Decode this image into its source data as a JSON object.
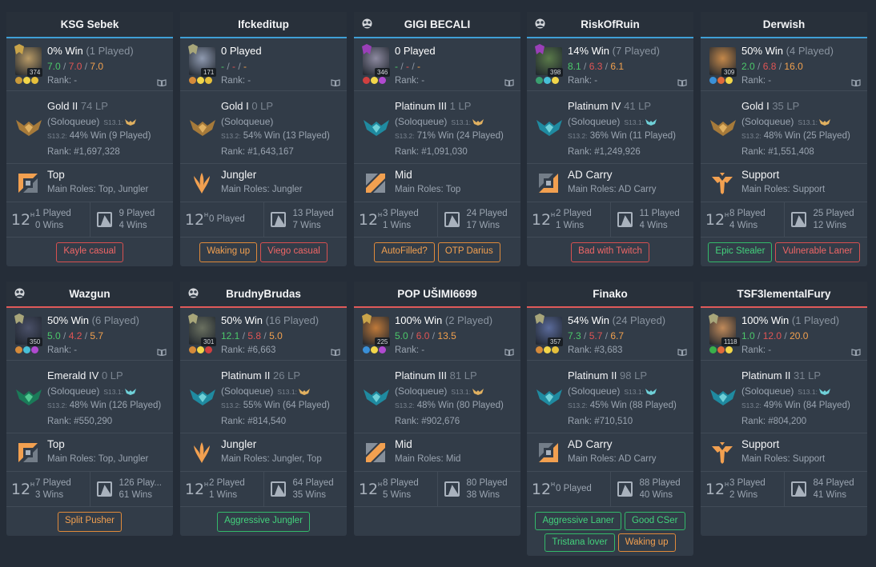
{
  "players": [
    {
      "name": "KSG Sebek",
      "team": "blue",
      "premade": false,
      "level": "374",
      "win": "0% Win",
      "played": "(1 Played)",
      "k": "7.0",
      "d": "7.0",
      "a": "7.0",
      "rank_line": "Rank: -",
      "tier": "Gold II",
      "lp": "74 LP",
      "queue": "(Soloqueue)",
      "prev_label": "S13.1:",
      "prev_tier": "gold",
      "season_label": "S13.2:",
      "season_stats": "44% Win (9 Played)",
      "ladder": "Rank: #1,697,328",
      "emblem": "gold",
      "role": "Top",
      "main_roles": "Main Roles: Top, Jungler",
      "role_icon": "top",
      "recent_played": "1 Played",
      "recent_wins": "0 Wins",
      "champ_played": "9 Played",
      "champ_wins": "4 Wins",
      "tags": [
        {
          "label": "Kayle casual",
          "color": "red"
        }
      ],
      "champ_color": "#b89a66",
      "crest": "#c9a44a",
      "runes": [
        "#c99a3a",
        "#f2d64a",
        "#e6c03c"
      ]
    },
    {
      "name": "Ifckeditup",
      "team": "blue",
      "premade": false,
      "level": "171",
      "win": "0 Played",
      "played": "",
      "k": "-",
      "d": "-",
      "a": "-",
      "rank_line": "Rank: -",
      "tier": "Gold I",
      "lp": "0 LP",
      "queue": "(Soloqueue)",
      "prev_label": "",
      "prev_tier": "",
      "season_label": "S13.2:",
      "season_stats": "54% Win (13 Played)",
      "ladder": "Rank: #1,643,167",
      "emblem": "gold",
      "role": "Jungler",
      "main_roles": "Main Roles: Jungler",
      "role_icon": "jungle",
      "recent_played": "0 Played",
      "recent_wins": "",
      "champ_played": "13 Played",
      "champ_wins": "7 Wins",
      "tags": [
        {
          "label": "Waking up",
          "color": "orange"
        },
        {
          "label": "Viego casual",
          "color": "red"
        }
      ],
      "champ_color": "#8f9ab0",
      "crest": "#a8a67a",
      "runes": [
        "#d48a3a",
        "#f2d64a",
        "#e6c03c"
      ]
    },
    {
      "name": "GIGI BECALI",
      "team": "blue",
      "premade": true,
      "level": "346",
      "win": "0 Played",
      "played": "",
      "k": "-",
      "d": "-",
      "a": "-",
      "rank_line": "Rank: -",
      "tier": "Platinum III",
      "lp": "1 LP",
      "queue": "(Soloqueue)",
      "prev_label": "S13.1:",
      "prev_tier": "gold",
      "season_label": "S13.2:",
      "season_stats": "71% Win (24 Played)",
      "ladder": "Rank: #1,091,030",
      "emblem": "platinum",
      "role": "Mid",
      "main_roles": "Main Roles: Top",
      "role_icon": "mid",
      "recent_played": "3 Played",
      "recent_wins": "1 Wins",
      "champ_played": "24 Played",
      "champ_wins": "17 Wins",
      "tags": [
        {
          "label": "AutoFilled?",
          "color": "orange"
        },
        {
          "label": "OTP Darius",
          "color": "orange"
        }
      ],
      "champ_color": "#8d8aa0",
      "crest": "#9a3fb8",
      "runes": [
        "#d04040",
        "#f2d64a",
        "#b04ad0"
      ]
    },
    {
      "name": "RiskOfRuin",
      "team": "blue",
      "premade": true,
      "level": "398",
      "win": "14% Win",
      "played": "(7 Played)",
      "k": "8.1",
      "d": "6.3",
      "a": "6.1",
      "rank_line": "Rank: -",
      "tier": "Platinum IV",
      "lp": "41 LP",
      "queue": "(Soloqueue)",
      "prev_label": "S13.1:",
      "prev_tier": "platinum",
      "season_label": "S13.2:",
      "season_stats": "36% Win (11 Played)",
      "ladder": "Rank: #1,249,926",
      "emblem": "platinum",
      "role": "AD Carry",
      "main_roles": "Main Roles: AD Carry",
      "role_icon": "bot",
      "recent_played": "2 Played",
      "recent_wins": "1 Wins",
      "champ_played": "11 Played",
      "champ_wins": "4 Wins",
      "tags": [
        {
          "label": "Bad with Twitch",
          "color": "red"
        }
      ],
      "champ_color": "#5a7a4a",
      "crest": "#9a3fb8",
      "runes": [
        "#3aa070",
        "#48c0d8",
        "#f2d64a"
      ]
    },
    {
      "name": "Derwish",
      "team": "blue",
      "premade": false,
      "level": "309",
      "win": "50% Win",
      "played": "(4 Played)",
      "k": "2.0",
      "d": "6.8",
      "a": "16.0",
      "rank_line": "Rank: -",
      "tier": "Gold I",
      "lp": "35 LP",
      "queue": "(Soloqueue)",
      "prev_label": "S13.1:",
      "prev_tier": "gold",
      "season_label": "S13.2:",
      "season_stats": "48% Win (25 Played)",
      "ladder": "Rank: #1,551,408",
      "emblem": "gold",
      "role": "Support",
      "main_roles": "Main Roles: Support",
      "role_icon": "support",
      "recent_played": "8 Played",
      "recent_wins": "4 Wins",
      "champ_played": "25 Played",
      "champ_wins": "12 Wins",
      "tags": [
        {
          "label": "Epic Stealer",
          "color": "green"
        },
        {
          "label": "Vulnerable Laner",
          "color": "red"
        }
      ],
      "champ_color": "#c4884a",
      "crest": "",
      "runes": [
        "#3a90d8",
        "#e06a3a",
        "#f2d64a"
      ]
    },
    {
      "name": "Wazgun",
      "team": "red",
      "premade": true,
      "level": "350",
      "win": "50% Win",
      "played": "(6 Played)",
      "k": "5.0",
      "d": "4.2",
      "a": "5.7",
      "rank_line": "Rank: -",
      "tier": "Emerald IV",
      "lp": "0 LP",
      "queue": "(Soloqueue)",
      "prev_label": "S13.1:",
      "prev_tier": "platinum",
      "season_label": "S13.2:",
      "season_stats": "48% Win (126 Played)",
      "ladder": "Rank: #550,290",
      "emblem": "emerald",
      "role": "Top",
      "main_roles": "Main Roles: Top, Jungler",
      "role_icon": "top",
      "recent_played": "7 Played",
      "recent_wins": "3 Wins",
      "champ_played": "126 Play...",
      "champ_wins": "61 Wins",
      "tags": [
        {
          "label": "Split Pusher",
          "color": "orange"
        }
      ],
      "champ_color": "#4a5068",
      "crest": "#a8a67a",
      "runes": [
        "#d48a3a",
        "#48c0d8",
        "#b04ad0"
      ]
    },
    {
      "name": "BrudnyBrudas",
      "team": "red",
      "premade": true,
      "level": "301",
      "win": "50% Win",
      "played": "(16 Played)",
      "k": "12.1",
      "d": "5.8",
      "a": "5.0",
      "rank_line": "Rank: #6,663",
      "tier": "Platinum II",
      "lp": "26 LP",
      "queue": "(Soloqueue)",
      "prev_label": "S13.1:",
      "prev_tier": "gold",
      "season_label": "S13.2:",
      "season_stats": "55% Win (64 Played)",
      "ladder": "Rank: #814,540",
      "emblem": "platinum",
      "role": "Jungler",
      "main_roles": "Main Roles: Jungler, Top",
      "role_icon": "jungle",
      "recent_played": "2 Played",
      "recent_wins": "1 Wins",
      "champ_played": "64 Played",
      "champ_wins": "35 Wins",
      "tags": [
        {
          "label": "Aggressive Jungler",
          "color": "green"
        }
      ],
      "champ_color": "#6a7060",
      "crest": "#a8a67a",
      "runes": [
        "#d48a3a",
        "#f2d64a",
        "#d04040"
      ]
    },
    {
      "name": "POP UŠIMI6699",
      "team": "red",
      "premade": false,
      "level": "225",
      "win": "100% Win",
      "played": "(2 Played)",
      "k": "5.0",
      "d": "6.0",
      "a": "13.5",
      "rank_line": "Rank: -",
      "tier": "Platinum III",
      "lp": "81 LP",
      "queue": "(Soloqueue)",
      "prev_label": "S13.1:",
      "prev_tier": "gold",
      "season_label": "S13.2:",
      "season_stats": "48% Win (80 Played)",
      "ladder": "Rank: #902,676",
      "emblem": "platinum",
      "role": "Mid",
      "main_roles": "Main Roles: Mid",
      "role_icon": "mid",
      "recent_played": "8 Played",
      "recent_wins": "5 Wins",
      "champ_played": "80 Played",
      "champ_wins": "38 Wins",
      "tags": [],
      "champ_color": "#c07a3a",
      "crest": "#c9a44a",
      "runes": [
        "#3a90d8",
        "#f2d64a",
        "#b04ad0"
      ]
    },
    {
      "name": "Finako",
      "team": "red",
      "premade": false,
      "level": "357",
      "win": "54% Win",
      "played": "(24 Played)",
      "k": "7.3",
      "d": "5.7",
      "a": "6.7",
      "rank_line": "Rank: #3,683",
      "tier": "Platinum II",
      "lp": "98 LP",
      "queue": "(Soloqueue)",
      "prev_label": "S13.1:",
      "prev_tier": "platinum",
      "season_label": "S13.2:",
      "season_stats": "45% Win (88 Played)",
      "ladder": "Rank: #710,510",
      "emblem": "platinum",
      "role": "AD Carry",
      "main_roles": "Main Roles: AD Carry",
      "role_icon": "bot",
      "recent_played": "0 Played",
      "recent_wins": "",
      "champ_played": "88 Played",
      "champ_wins": "40 Wins",
      "tags": [
        {
          "label": "Aggressive Laner",
          "color": "green"
        },
        {
          "label": "Good CSer",
          "color": "green"
        },
        {
          "label": "Tristana lover",
          "color": "green"
        },
        {
          "label": "Waking up",
          "color": "orange"
        }
      ],
      "champ_color": "#5a6a9a",
      "crest": "#a8a67a",
      "runes": [
        "#d48a3a",
        "#f2d64a",
        "#e6c03c"
      ]
    },
    {
      "name": "TSF3lementalFury",
      "team": "red",
      "premade": false,
      "level": "1118",
      "win": "100% Win",
      "played": "(1 Played)",
      "k": "1.0",
      "d": "12.0",
      "a": "20.0",
      "rank_line": "Rank: -",
      "tier": "Platinum II",
      "lp": "31 LP",
      "queue": "(Soloqueue)",
      "prev_label": "S13.1:",
      "prev_tier": "platinum",
      "season_label": "S13.2:",
      "season_stats": "49% Win (84 Played)",
      "ladder": "Rank: #804,200",
      "emblem": "platinum",
      "role": "Support",
      "main_roles": "Main Roles: Support",
      "role_icon": "support",
      "recent_played": "3 Played",
      "recent_wins": "2 Wins",
      "champ_played": "84 Played",
      "champ_wins": "41 Wins",
      "tags": [],
      "champ_color": "#c08a5a",
      "crest": "#a8a67a",
      "runes": [
        "#3ab04a",
        "#e06a3a",
        "#f2d64a"
      ]
    }
  ],
  "colors": {
    "blue_team": "#3f9fd6",
    "red_team": "#e05a5a",
    "kills": "#4cc86a",
    "deaths": "#e05555",
    "assists": "#f0a04e",
    "tag_green": "#43d27c",
    "tag_orange": "#f2a050",
    "tag_red": "#f06666"
  },
  "icons": {
    "premade": "group-icon",
    "book": "build-book-icon",
    "recent": "recent-12h-icon",
    "champion_stats": "champion-stats-icon"
  }
}
